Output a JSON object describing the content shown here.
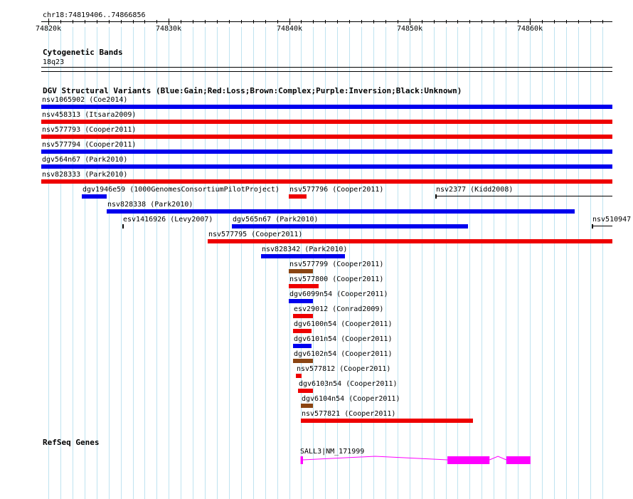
{
  "ruler": {
    "region": "chr18:74819406..74866856",
    "ticks": [
      "74820k",
      "74830k",
      "74840k",
      "74850k",
      "74860k"
    ]
  },
  "cytobands": {
    "title": "Cytogenetic Bands",
    "band": "18q23"
  },
  "dgv": {
    "title": "DGV Structural Variants (Blue:Gain;Red:Loss;Brown:Complex;Purple:Inversion;Black:Unknown)",
    "type_colors": {
      "gain": "#0000ee",
      "loss": "#ee0000",
      "complex": "#8b4513",
      "unknown": "#000000"
    },
    "variants": [
      {
        "label": "nsv1065902 (Coe2014)",
        "type": "gain",
        "start": 74819406,
        "end": 74866856
      },
      {
        "label": "nsv458313 (Itsara2009)",
        "type": "loss",
        "start": 74819406,
        "end": 74866856
      },
      {
        "label": "nsv577793 (Cooper2011)",
        "type": "loss",
        "start": 74819406,
        "end": 74866856
      },
      {
        "label": "nsv577794 (Cooper2011)",
        "type": "gain",
        "start": 74819406,
        "end": 74866856
      },
      {
        "label": "dgv564n67 (Park2010)",
        "type": "gain",
        "start": 74819406,
        "end": 74866856
      },
      {
        "label": "nsv828333 (Park2010)",
        "type": "loss",
        "start": 74819406,
        "end": 74866856
      },
      {
        "label": "dgv1946e59 (1000GenomesConsortiumPilotProject)",
        "type": "gain",
        "start": 74822750,
        "end": 74824850
      },
      {
        "label": "nsv577796 (Cooper2011)",
        "type": "loss",
        "start": 74839950,
        "end": 74841450
      },
      {
        "label": "nsv2377 (Kidd2008)",
        "type": "unknown",
        "start": 74852150,
        "end": 74866856
      },
      {
        "label": "nsv828338 (Park2010)",
        "type": "gain",
        "start": 74824850,
        "end": 74863750
      },
      {
        "label": "esv1416926 (Levy2007)",
        "type": "unknown",
        "start": 74826150,
        "end": 74826250
      },
      {
        "label": "dgv565n67 (Park2010)",
        "type": "gain",
        "start": 74835250,
        "end": 74854850
      },
      {
        "label": "nsv510947 (Teague2010)",
        "type": "unknown",
        "start": 74865150,
        "end": 74866856
      },
      {
        "label": "nsv577795 (Cooper2011)",
        "type": "loss",
        "start": 74833250,
        "end": 74866856
      },
      {
        "label": "nsv828342 (Park2010)",
        "type": "gain",
        "start": 74837650,
        "end": 74844650
      },
      {
        "label": "nsv577799 (Cooper2011)",
        "type": "complex",
        "start": 74839950,
        "end": 74841950
      },
      {
        "label": "nsv577800 (Cooper2011)",
        "type": "loss",
        "start": 74839950,
        "end": 74842450
      },
      {
        "label": "dgv6099n54 (Cooper2011)",
        "type": "gain",
        "start": 74839950,
        "end": 74841950
      },
      {
        "label": "esv29012 (Conrad2009)",
        "type": "loss",
        "start": 74840350,
        "end": 74841950
      },
      {
        "label": "dgv6100n54 (Cooper2011)",
        "type": "loss",
        "start": 74840350,
        "end": 74841850
      },
      {
        "label": "dgv6101n54 (Cooper2011)",
        "type": "gain",
        "start": 74840350,
        "end": 74841850
      },
      {
        "label": "dgv6102n54 (Cooper2011)",
        "type": "complex",
        "start": 74840350,
        "end": 74841950
      },
      {
        "label": "nsv577812 (Cooper2011)",
        "type": "loss",
        "start": 74840550,
        "end": 74841050
      },
      {
        "label": "dgv6103n54 (Cooper2011)",
        "type": "loss",
        "start": 74840750,
        "end": 74841950
      },
      {
        "label": "dgv6104n54 (Cooper2011)",
        "type": "complex",
        "start": 74840950,
        "end": 74841950
      },
      {
        "label": "nsv577821 (Cooper2011)",
        "type": "loss",
        "start": 74840950,
        "end": 74855250
      }
    ]
  },
  "refseq": {
    "title": "RefSeq Genes",
    "gene": {
      "label": "SALL3|NM_171999",
      "color": "#ff00ff",
      "start": 74840950,
      "end": 74860050,
      "exons": [
        [
          74840950,
          74841150
        ],
        [
          74853150,
          74856650
        ],
        [
          74858050,
          74860050
        ]
      ]
    }
  }
}
